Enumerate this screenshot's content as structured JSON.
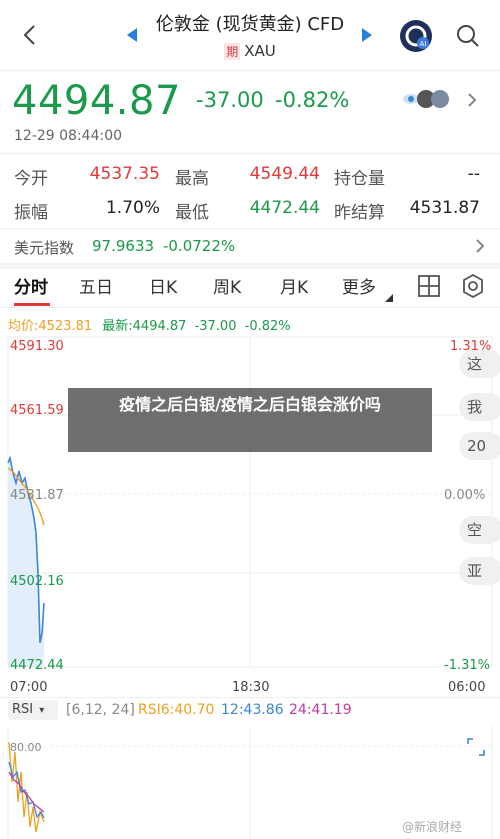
{
  "header": {
    "title": "伦敦金 (现货黄金) CFD",
    "badge": "期",
    "symbol": "XAU"
  },
  "quote": {
    "price": "4494.87",
    "change": "-37.00",
    "change_pct": "-0.82%",
    "time": "12-29 08:44:00"
  },
  "stats": [
    {
      "label": "今开",
      "value": "4537.35",
      "color": "#e0393a"
    },
    {
      "label": "最高",
      "value": "4549.44",
      "color": "#e0393a"
    },
    {
      "label": "持仓量",
      "value": "--",
      "color": "#222222"
    },
    {
      "label": "振幅",
      "value": "1.70%",
      "color": "#222222"
    },
    {
      "label": "最低",
      "value": "4472.44",
      "color": "#1a9a4a"
    },
    {
      "label": "昨结算",
      "value": "4531.87",
      "color": "#222222"
    }
  ],
  "index_bar": {
    "label": "美元指数",
    "value": "97.9633",
    "change": "-0.0722%"
  },
  "tabs": [
    "分时",
    "五日",
    "日K",
    "周K",
    "月K",
    "更多"
  ],
  "legend": {
    "avg": "均价:4523.81",
    "latest": "最新:4494.87",
    "change": "-37.00",
    "pct": "-0.82%"
  },
  "axis": {
    "y_left": [
      "4591.30",
      "4561.59",
      "4531.87",
      "4502.16",
      "4472.44"
    ],
    "y_right": [
      "1.31%",
      "0.00%",
      "-1.31%"
    ],
    "x": [
      "07:00",
      "18:30",
      "06:00"
    ]
  },
  "side_buttons": [
    "这",
    "我",
    "20",
    "空",
    "亚"
  ],
  "overlay_text": "疫情之后白银/疫情之后白银会涨价吗",
  "rsi": {
    "selector": "RSI",
    "params": "[6,12, 24]",
    "rsi6": "RSI6:40.70",
    "rsi12": "12:43.86",
    "rsi24": "24:41.19",
    "top_tick": "80.00"
  },
  "watermark": "@新浪财经",
  "colors": {
    "up": "#e0393a",
    "down": "#1a9a4a",
    "price_line": "#3a86d8",
    "avg_line": "#f0a020",
    "rsi24": "#c03aa0"
  }
}
